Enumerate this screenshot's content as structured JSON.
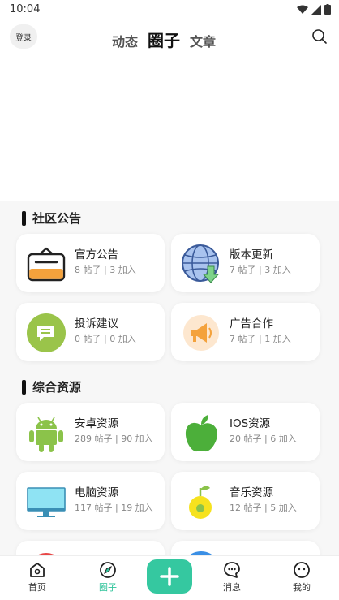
{
  "status_bar": {
    "time": "10:04"
  },
  "header": {
    "login_label": "登录",
    "tabs": [
      {
        "label": "动态",
        "active": false
      },
      {
        "label": "圈子",
        "active": true
      },
      {
        "label": "文章",
        "active": false
      }
    ]
  },
  "sections": [
    {
      "title": "社区公告",
      "cards": [
        {
          "name": "官方公告",
          "meta": "8 帖子 | 3 加入",
          "icon": "announcement-box-icon"
        },
        {
          "name": "版本更新",
          "meta": "7 帖子 | 3 加入",
          "icon": "globe-download-icon"
        },
        {
          "name": "投诉建议",
          "meta": "0 帖子 | 0 加入",
          "icon": "chat-bubble-icon"
        },
        {
          "name": "广告合作",
          "meta": "7 帖子 | 1 加入",
          "icon": "megaphone-icon"
        }
      ]
    },
    {
      "title": "综合资源",
      "cards": [
        {
          "name": "安卓资源",
          "meta": "289 帖子 | 90 加入",
          "icon": "android-icon"
        },
        {
          "name": "IOS资源",
          "meta": "20 帖子 | 6 加入",
          "icon": "apple-icon"
        },
        {
          "name": "电脑资源",
          "meta": "117 帖子 | 19 加入",
          "icon": "monitor-icon"
        },
        {
          "name": "音乐资源",
          "meta": "12 帖子 | 5 加入",
          "icon": "music-fruit-icon"
        }
      ]
    }
  ],
  "bottom_nav": {
    "items": [
      {
        "label": "首页",
        "icon": "home-icon"
      },
      {
        "label": "圈子",
        "icon": "compass-icon",
        "active": true
      },
      {
        "label": "消息",
        "icon": "message-icon"
      },
      {
        "label": "我的",
        "icon": "profile-icon"
      }
    ]
  },
  "colors": {
    "accent": "#35c8a0",
    "active_text": "#2fc39a"
  }
}
